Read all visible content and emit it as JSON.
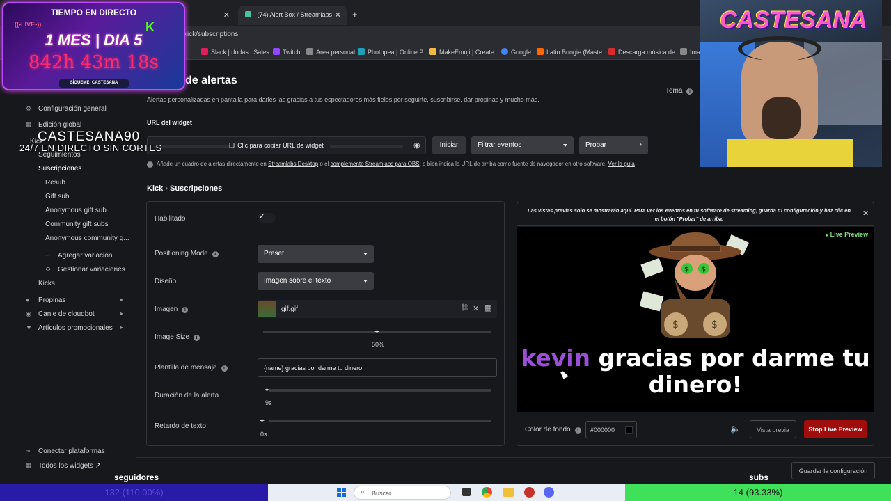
{
  "browser": {
    "tabs": [
      {
        "label": ""
      },
      {
        "label": "(74) Alert Box / Streamlabs"
      }
    ],
    "new_tab_symbol": "+",
    "close_symbol": "✕",
    "url": "kick/subscriptions",
    "bookmarks": [
      {
        "label": "Slack | dudas | Sales...",
        "color": "#e01e5a"
      },
      {
        "label": "Twitch",
        "color": "#9146ff"
      },
      {
        "label": "Área personal",
        "color": "#888888"
      },
      {
        "label": "Photopea | Online P...",
        "color": "#1ea0b8"
      },
      {
        "label": "MakeEmoji | Create...",
        "color": "#f4b942"
      },
      {
        "label": "Google",
        "color": "#4285f4"
      },
      {
        "label": "Latin Boogie (Maste...",
        "color": "#ff6a00"
      },
      {
        "label": "Descarga música de...",
        "color": "#d82c2c"
      },
      {
        "label": "Ima",
        "color": "#888888"
      }
    ]
  },
  "overlay": {
    "timer_title": "TIEMPO EN DIRECTO",
    "live_badge": "((•LIVE•))",
    "kick_logo": "K",
    "timer_days": "1 MES | DIA 5",
    "timer_hours": "842h 43m 18s",
    "follow_text": "SÍGUEME: CASTESANA",
    "channel_name": "CASTESANA90",
    "channel_sub": "24/7 EN DIRECTO SIN CORTES",
    "webcam_logo": "CASTESANA"
  },
  "sidebar": {
    "items": [
      {
        "label": "Configuración general",
        "icon": "gear-icon"
      },
      {
        "label": "Edición global",
        "icon": "grid-icon"
      },
      {
        "label": "Kick",
        "icon": ""
      },
      {
        "label": "Seguimientos",
        "icon": ""
      },
      {
        "label": "Suscripciones",
        "icon": ""
      },
      {
        "label": "Resub",
        "icon": ""
      },
      {
        "label": "Gift sub",
        "icon": ""
      },
      {
        "label": "Anonymous gift sub",
        "icon": ""
      },
      {
        "label": "Community gift subs",
        "icon": ""
      },
      {
        "label": "Anonymous community g...",
        "icon": ""
      },
      {
        "label": "Agregar variación",
        "icon": "plus-icon"
      },
      {
        "label": "Gestionar variaciones",
        "icon": "gear-icon"
      },
      {
        "label": "Kicks",
        "icon": ""
      },
      {
        "label": "Propinas",
        "icon": "coin-icon"
      },
      {
        "label": "Canje de cloudbot",
        "icon": "bot-icon"
      },
      {
        "label": "Artículos promocionales",
        "icon": "shirt-icon"
      },
      {
        "label": "Conectar plataformas",
        "icon": "link-icon"
      },
      {
        "label": "Todos los widgets",
        "icon": "grid-icon"
      }
    ],
    "chevron": "▸",
    "external": "↗"
  },
  "main": {
    "title": "de alertas",
    "theme_label": "Tema",
    "description": "Alertas personalizadas en pantalla para darles las gracias a tus espectadores más fieles por seguirte, suscribirse, dar propinas y mucho más.",
    "widget_url_label": "URL del widget",
    "copy_url_label": "Clic para copiar URL de widget",
    "start_button": "Iniciar",
    "filter_select": "Filtrar eventos",
    "test_button": "Probar",
    "hint_prefix": "Añade un cuadro de alertas directamente en",
    "hint_link1": "Streamlabs Desktop",
    "hint_mid": "o el",
    "hint_link2": "complemento Streamlabs para OBS",
    "hint_suffix": ", o bien indica la URL de arriba como fuente de navegador en otro software.",
    "hint_link3": "Ver la guía",
    "breadcrumb_parent": "Kick",
    "breadcrumb_sep": "›",
    "breadcrumb_current": "Suscripciones",
    "save_button": "Guardar la configuración"
  },
  "settings": {
    "enabled_label": "Habilitado",
    "enabled_check": "✓",
    "positioning_label": "Positioning Mode",
    "positioning_value": "Preset",
    "design_label": "Diseño",
    "design_value": "Imagen sobre el texto",
    "image_label": "Imagen",
    "image_file": "gif.gif",
    "image_size_label": "Image Size",
    "image_size_value": "50%",
    "image_size_fraction": 0.5,
    "template_label": "Plantilla de mensaje",
    "template_value": "{name} gracias por darme tu dinero!",
    "duration_label": "Duración de la alerta",
    "duration_value": "9s",
    "text_delay_label": "Retardo de texto",
    "text_delay_value": "0s"
  },
  "preview": {
    "notice": "Las vistas previas solo se mostrarán aquí. Para ver los eventos en tu software de streaming, guarda tu configuración y haz clic en el botón \"Probar\" de arriba.",
    "live_preview_label": "Live Preview",
    "name": "kevin",
    "message_line1": "gracias por darme tu",
    "message_line2": "dinero!",
    "name_color": "#9b4fd6",
    "bg_color_label": "Color de fondo",
    "bg_color_value": "#000000",
    "preview_button": "Vista previa",
    "stop_button": "Stop Live Preview"
  },
  "stream_bar": {
    "left_title": "seguidores",
    "left_value": "132 (110.00%)",
    "right_title": "subs",
    "right_value": "14 (93.33%)",
    "left_color": "#2a1aa8",
    "right_color": "#3fe05a"
  },
  "taskbar": {
    "search_placeholder": "Buscar"
  }
}
